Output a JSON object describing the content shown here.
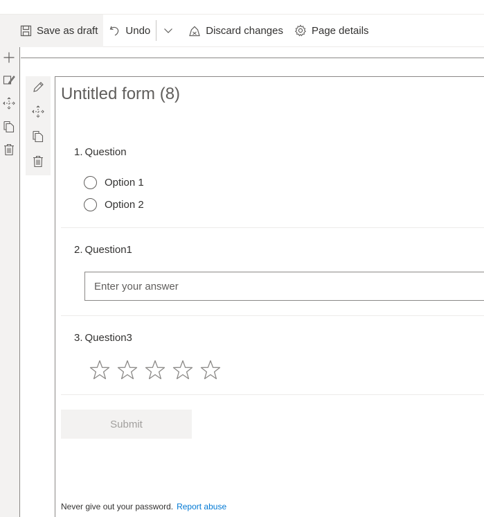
{
  "command_bar": {
    "save_draft": "Save as draft",
    "undo": "Undo",
    "discard": "Discard changes",
    "page_details": "Page details"
  },
  "left_rail": {
    "icons": [
      "add-icon",
      "edit-section-icon",
      "move-icon",
      "duplicate-icon",
      "delete-icon"
    ]
  },
  "webpart_toolbar": {
    "icons": [
      "edit-icon",
      "move-icon",
      "duplicate-icon",
      "delete-icon"
    ]
  },
  "form": {
    "title": "Untitled form (8)",
    "questions": [
      {
        "number": "1.",
        "label": "Question",
        "type": "choice",
        "options": [
          "Option 1",
          "Option 2"
        ]
      },
      {
        "number": "2.",
        "label": "Question1",
        "type": "text",
        "placeholder": "Enter your answer"
      },
      {
        "number": "3.",
        "label": "Question3",
        "type": "rating",
        "stars": 5,
        "value": 0
      }
    ],
    "submit_label": "Submit"
  },
  "footer": {
    "warning": "Never give out your password.",
    "report_link": "Report abuse"
  },
  "colors": {
    "accent": "#0078d4",
    "rail_bg": "#f3f2f1",
    "border": "#8a8886",
    "star": "#8a8886"
  }
}
